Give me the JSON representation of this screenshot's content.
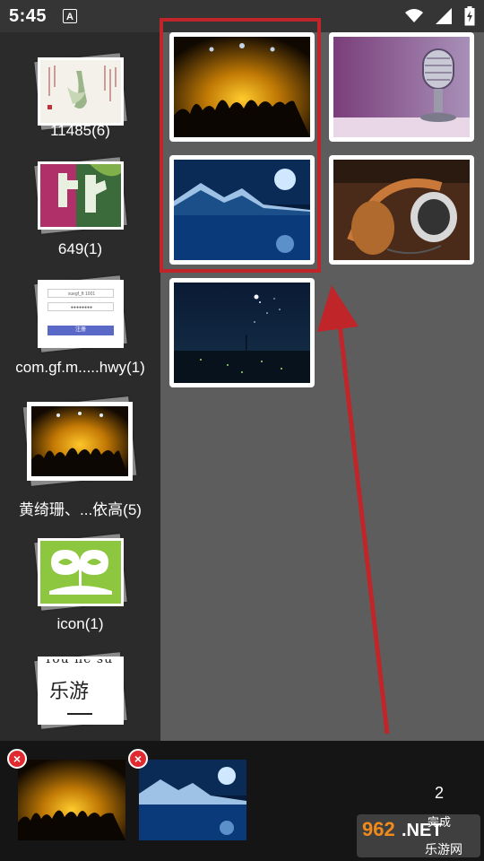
{
  "status_bar": {
    "time": "5:45",
    "notification_glyph": "A",
    "icons": [
      "wifi-icon",
      "signal-icon",
      "battery-icon"
    ]
  },
  "albums": [
    {
      "label": "11485(6)",
      "thumb": "calligraphy-painting"
    },
    {
      "label": "649(1)",
      "thumb": "game-logo"
    },
    {
      "label": "com.gf.m.....hwy(1)",
      "thumb": "login-form",
      "thumb_text": {
        "field_1": "xuegf_ft 1001",
        "field_2": "●●●●●●●●",
        "button": "注册"
      }
    },
    {
      "label": "黄绮珊、...依高(5)",
      "thumb": "concert-crowd"
    },
    {
      "label": "icon(1)",
      "thumb": "green-app-icon"
    },
    {
      "label": "",
      "thumb": "handwriting",
      "thumb_text": "乐游"
    }
  ],
  "photos": [
    {
      "name": "concert-crowd"
    },
    {
      "name": "vintage-microphone"
    },
    {
      "name": "moonlit-lake"
    },
    {
      "name": "headphones-on-desk"
    },
    {
      "name": "night-sky-field"
    }
  ],
  "selection_tray": {
    "items": [
      {
        "name": "concert-crowd"
      },
      {
        "name": "moonlit-lake"
      }
    ],
    "count": "2",
    "done_label": "完成"
  },
  "watermark": {
    "text_962": "962",
    "text_net": ".NET",
    "text_site": "乐游网"
  },
  "colors": {
    "highlight": "#c0252a",
    "remove_badge": "#e02a30",
    "grid_bg": "#5d5d5d",
    "sidebar_bg": "#2b2b2b",
    "tray_bg": "#151515"
  }
}
